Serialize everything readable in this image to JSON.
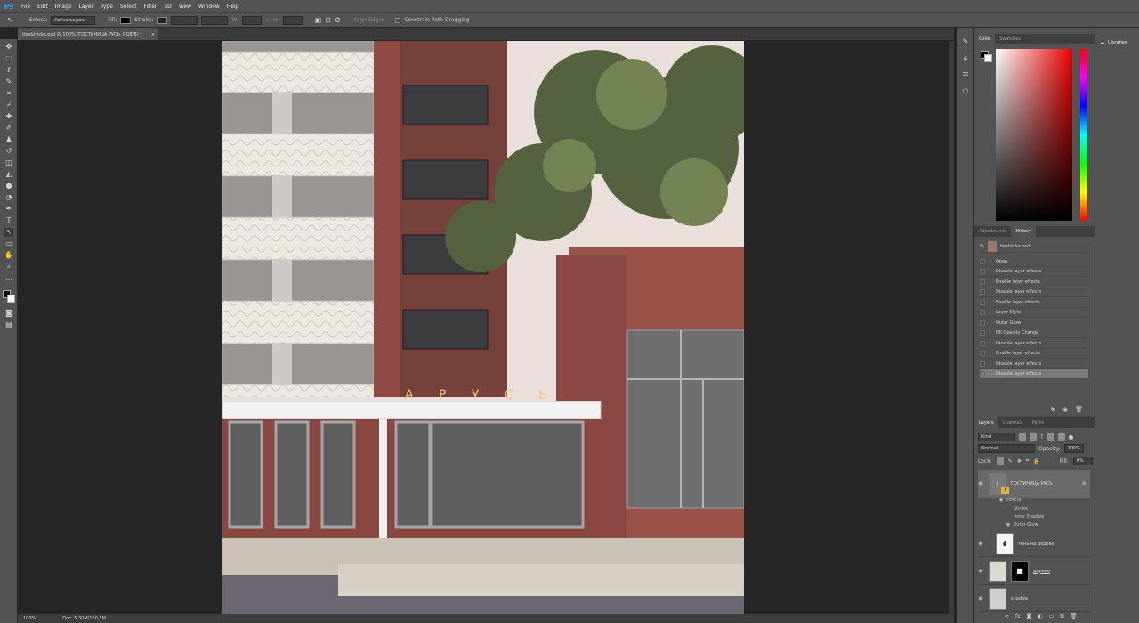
{
  "app": {
    "logo": "Ps"
  },
  "menu": [
    "File",
    "Edit",
    "Image",
    "Layer",
    "Type",
    "Select",
    "Filter",
    "3D",
    "View",
    "Window",
    "Help"
  ],
  "options": {
    "select_label": "Select:",
    "select_value": "Active Layers",
    "fill_label": "Fill:",
    "stroke_label": "Stroke:",
    "w_label": "W:",
    "h_label": "H:",
    "align_edges": "Align Edges",
    "constrain": "Constrain Path Dragging"
  },
  "document": {
    "tab_title": "tips&tricks.psd @ 100% (ГОСТИНИЦА РУСЬ, RGB/8) *",
    "sign_text": "ГОСТИНИЦА РУСЬ",
    "sign_visible": "А Р У С Ь"
  },
  "status": {
    "zoom": "100%",
    "doc": "Doc: 5,30M/100,5M"
  },
  "panels": {
    "color_tabs": [
      "Color",
      "Swatches"
    ],
    "history_tabs": [
      "Adjustments",
      "History"
    ],
    "history_snapshot": "tipstricks.psd",
    "history_items": [
      "Open",
      "Disable layer effects",
      "Enable layer effects",
      "Disable layer effects",
      "Enable layer effects",
      "Layer Style",
      "Outer Glow",
      "Fill Opacity Change",
      "Disable layer effects",
      "Enable layer effects",
      "Disable layer effects",
      "Disable layer effects"
    ],
    "layers_tabs": [
      "Layers",
      "Channels",
      "Paths"
    ],
    "kind": "Kind",
    "blend_mode": "Normal",
    "opacity_label": "Opacity:",
    "opacity_value": "100%",
    "lock_label": "Lock:",
    "fill_label": "Fill:",
    "fill_value": "0%",
    "libraries": "Libraries"
  },
  "layers": [
    {
      "name": "ГОСТИНИЦА РУСЬ",
      "type": "text"
    },
    {
      "name": "тень на дереве",
      "type": "pixel"
    },
    {
      "name": "дерево",
      "type": "masked"
    },
    {
      "name": "shadow",
      "type": "pixel"
    }
  ],
  "effects": {
    "title": "Effects",
    "items": [
      "Stroke",
      "Inner Shadow",
      "Outer Glow"
    ]
  },
  "colors": {
    "accent": "#31a8ff",
    "panel": "#535353",
    "dark": "#262626",
    "brick": "#8e4a43"
  }
}
